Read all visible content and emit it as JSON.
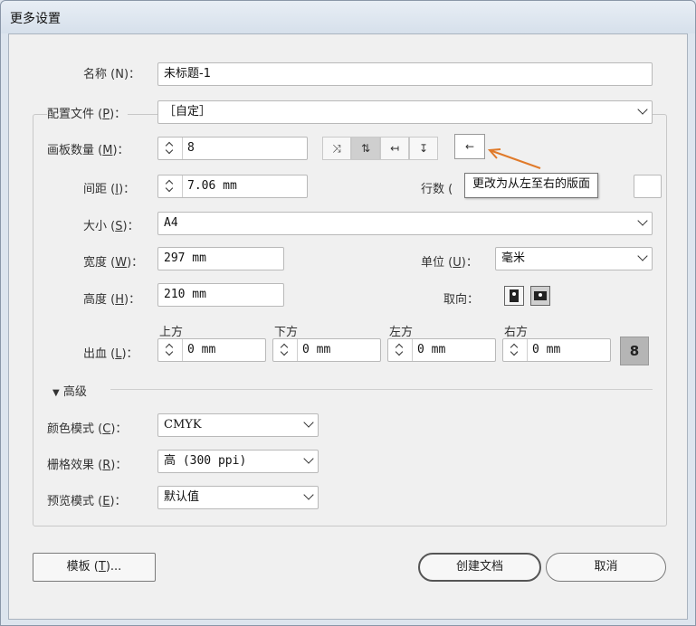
{
  "window": {
    "title": "更多设置"
  },
  "name": {
    "label": "名称",
    "key": "N",
    "value": "未标题-1"
  },
  "profile": {
    "label": "配置文件",
    "key": "P",
    "value": "［自定］"
  },
  "artboards": {
    "count_label": "画板数量",
    "count_key": "M",
    "count_value": "8",
    "layout_icons": [
      "grid-by-row-icon",
      "grid-by-column-icon",
      "arrange-by-row-icon",
      "arrange-by-column-icon"
    ],
    "direction_arrow": "←",
    "tooltip": "更改为从左至右的版面"
  },
  "spacing": {
    "label": "间距",
    "key": "I",
    "value": "7.06 mm",
    "rows_label": "行数"
  },
  "size": {
    "label": "大小",
    "key": "S",
    "value": "A4"
  },
  "width": {
    "label": "宽度",
    "key": "W",
    "value": "297 mm"
  },
  "units": {
    "label": "单位",
    "key": "U",
    "value": "毫米"
  },
  "height": {
    "label": "高度",
    "key": "H",
    "value": "210 mm"
  },
  "orientation": {
    "label": "取向：",
    "options": [
      "portrait-icon",
      "landscape-icon"
    ],
    "selected": "landscape"
  },
  "bleed": {
    "label": "出血",
    "key": "L",
    "top_label": "上方",
    "top": "0 mm",
    "bottom_label": "下方",
    "bottom": "0 mm",
    "left_label": "左方",
    "left": "0 mm",
    "right_label": "右方",
    "right": "0 mm",
    "link_glyph": "8"
  },
  "advanced": {
    "label": "高级"
  },
  "color_mode": {
    "label": "颜色模式",
    "key": "C",
    "value": "CMYK"
  },
  "raster": {
    "label": "栅格效果",
    "key": "R",
    "value": "高 (300 ppi)"
  },
  "preview": {
    "label": "预览模式",
    "key": "E",
    "value": "默认值"
  },
  "buttons": {
    "templates": "模板",
    "templates_key": "T",
    "templates_suffix": "...",
    "create": "创建文档",
    "cancel": "取消"
  }
}
